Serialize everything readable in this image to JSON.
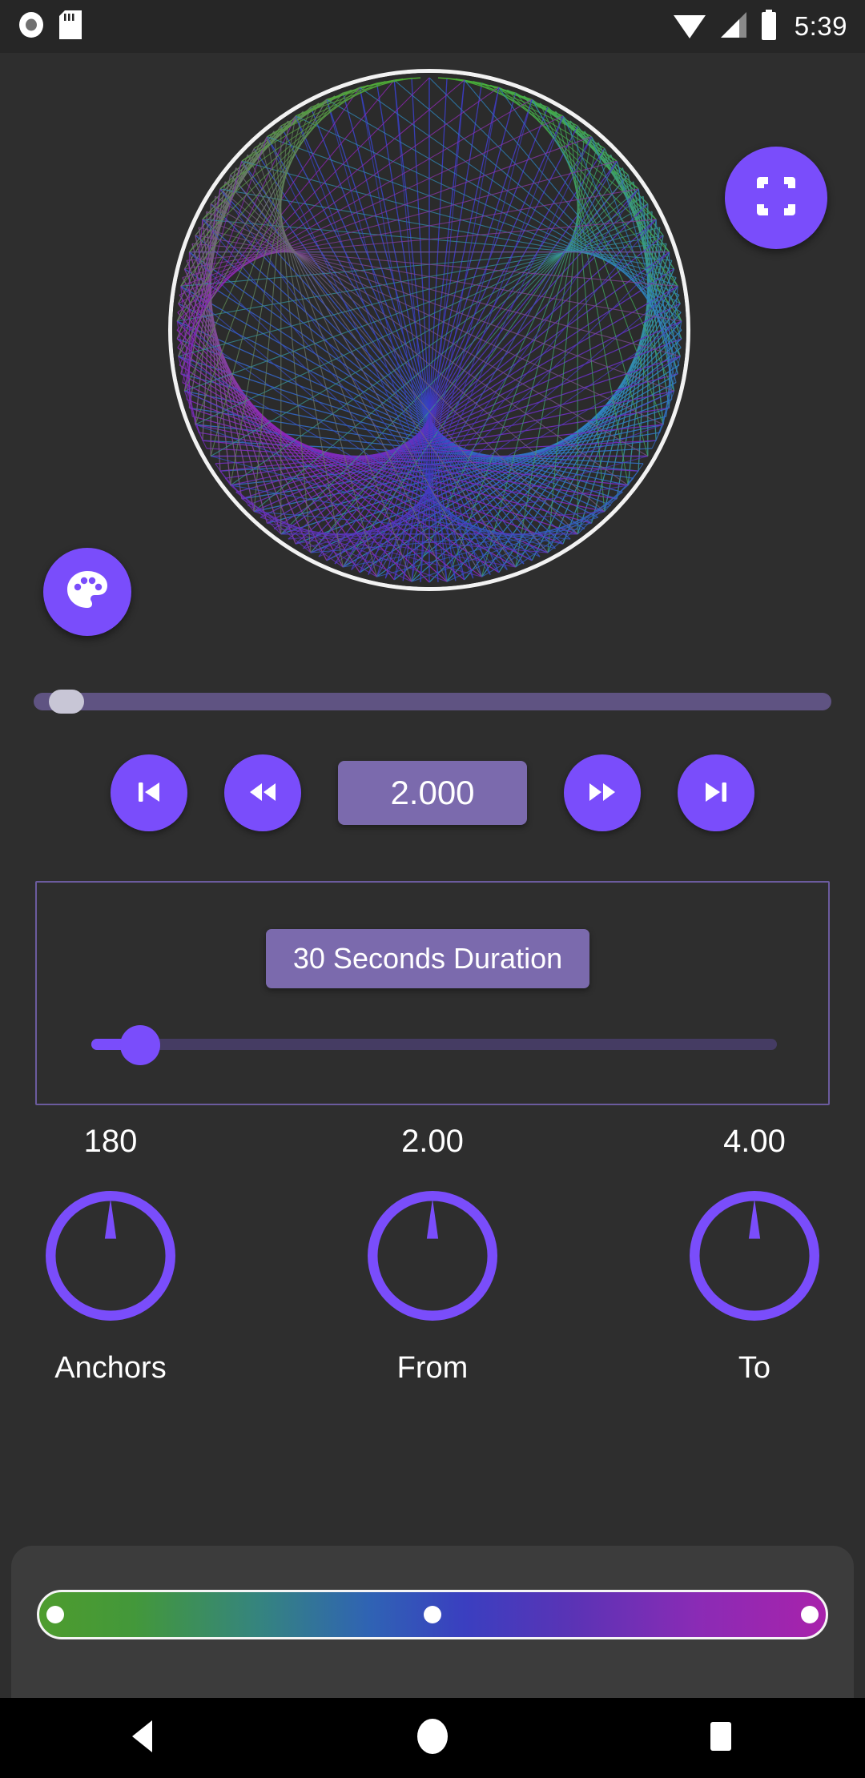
{
  "status_bar": {
    "time": "5:39",
    "icons": [
      {
        "name": "record-icon"
      },
      {
        "name": "sd-card-icon"
      },
      {
        "name": "wifi-icon"
      },
      {
        "name": "cellular-signal-icon"
      },
      {
        "name": "battery-icon"
      }
    ]
  },
  "canvas": {
    "art_name": "string-art-spirograph",
    "fullscreen_icon": "fullscreen-icon",
    "palette_icon": "palette-icon",
    "ring_color": "#f2f2f2",
    "background": "#2b2b2b"
  },
  "progress": {
    "name": "playback-progress",
    "value_percent": 2,
    "track_color": "#5f5382",
    "thumb_color": "#c8c6d6"
  },
  "transport": {
    "skip_previous_label": "skip-previous",
    "rewind_label": "rewind",
    "speed_value": "2.000",
    "fast_forward_label": "fast-forward",
    "skip_next_label": "skip-next",
    "button_color": "#7a4dfb",
    "speed_box_color": "#7b6aad"
  },
  "duration": {
    "chip_label": "30 Seconds Duration",
    "slider_percent": 5,
    "border_color": "#6b5b9e",
    "accent": "#7a4dfb"
  },
  "knobs": [
    {
      "value": "180",
      "label": "Anchors",
      "angle_deg": 0
    },
    {
      "value": "2.00",
      "label": "From",
      "angle_deg": 0
    },
    {
      "value": "4.00",
      "label": "To",
      "angle_deg": 0
    }
  ],
  "gradient": {
    "name": "color-gradient-picker",
    "stops": [
      "#4e9c2e",
      "#2f63b4",
      "#a822ab"
    ],
    "handle_positions_percent": [
      2,
      50,
      98
    ],
    "border_color": "#f5f5f5",
    "sheet_color": "#3c3c3c"
  },
  "nav_bar": {
    "back_label": "back",
    "home_label": "home",
    "recents_label": "recents"
  },
  "theme": {
    "accent": "#7a4dfb",
    "background": "#2e2e2e",
    "status_bar_bg": "#262626",
    "text": "#ffffff"
  }
}
